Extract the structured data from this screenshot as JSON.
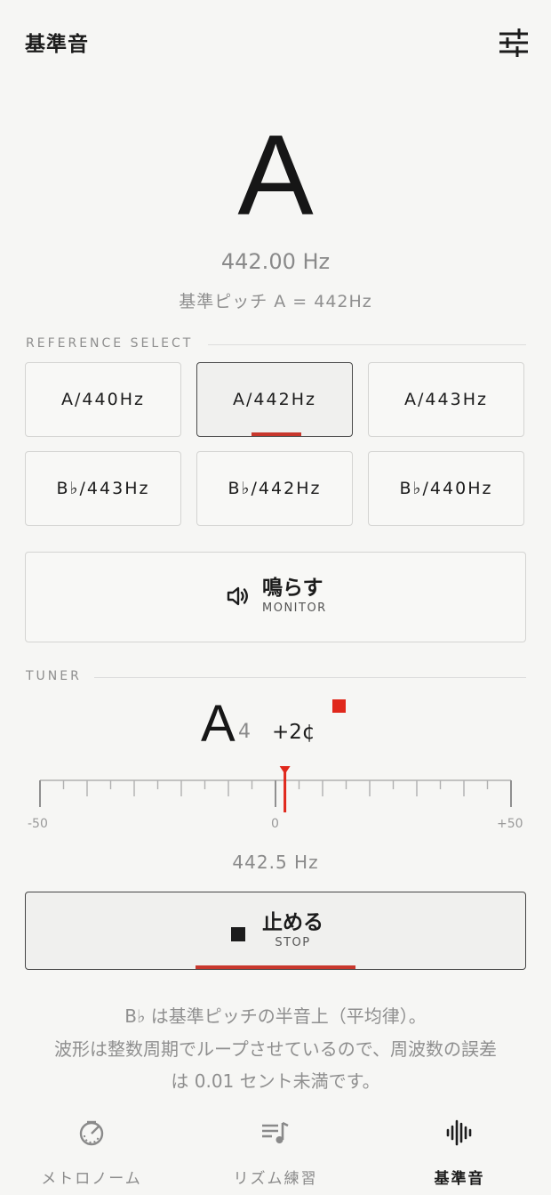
{
  "header": {
    "title": "基準音",
    "settings_icon": "sliders-icon"
  },
  "display": {
    "note": "A",
    "frequency": "442.00 Hz",
    "pitch_description": "基準ピッチ A = 442Hz"
  },
  "reference_select": {
    "label": "REFERENCE SELECT",
    "options": [
      "A/440Hz",
      "A/442Hz",
      "A/443Hz",
      "B♭/443Hz",
      "B♭/442Hz",
      "B♭/440Hz"
    ],
    "selected_index": 1
  },
  "monitor_button": {
    "label": "鳴らす",
    "sublabel": "MONITOR",
    "icon": "speaker-icon"
  },
  "tuner": {
    "label": "TUNER",
    "note": "A",
    "octave": "4",
    "cents": "+2¢",
    "scale_min": "-50",
    "scale_mid": "0",
    "scale_max": "+50",
    "cents_value": 2,
    "frequency": "442.5 Hz",
    "indicator_color": "#e0281c"
  },
  "stop_button": {
    "label": "止める",
    "sublabel": "STOP",
    "icon": "stop-square-icon"
  },
  "info_text": {
    "line1": "B♭ は基準ピッチの半音上（平均律）。",
    "line2": "波形は整数周期でループさせているので、周波数の誤差",
    "line3": "は 0.01 セント未満です。"
  },
  "tabs": [
    {
      "label": "メトロノーム",
      "icon": "metronome-icon",
      "active": false
    },
    {
      "label": "リズム練習",
      "icon": "playlist-note-icon",
      "active": false
    },
    {
      "label": "基準音",
      "icon": "waveform-icon",
      "active": true
    }
  ],
  "colors": {
    "accent": "#c8372c",
    "background": "#f6f6f4",
    "text": "#1c1c1c"
  }
}
